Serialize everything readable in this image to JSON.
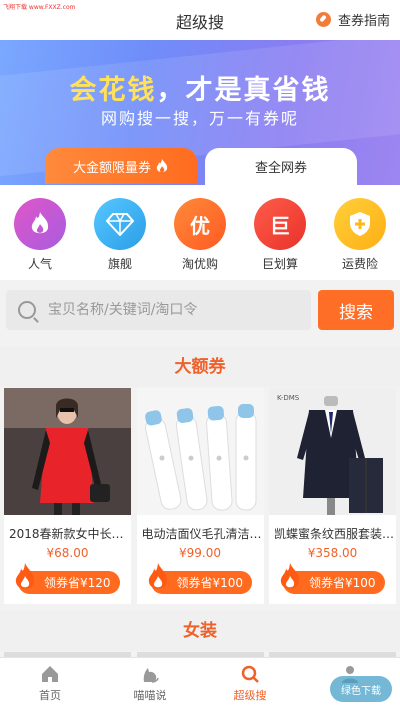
{
  "watermark": "飞翔下载 www.FXXZ.com",
  "header": {
    "title": "超级搜",
    "guide_label": "查券指南"
  },
  "banner": {
    "headline_highlight": "会花钱",
    "headline_rest": "，才是真省钱",
    "subtitle": "网购搜一搜，万一有券呢",
    "tabs": [
      {
        "label": "大金额限量券"
      },
      {
        "label": "查全网券"
      }
    ]
  },
  "categories": [
    {
      "label": "人气",
      "icon": "flame-icon",
      "color": "#c35bd6",
      "glyph": ""
    },
    {
      "label": "旗舰",
      "icon": "diamond-icon",
      "color": "#3fb4f1",
      "glyph": ""
    },
    {
      "label": "淘优购",
      "icon": "you-icon",
      "color": "#ff6b2e",
      "glyph": "优"
    },
    {
      "label": "巨划算",
      "icon": "ju-icon",
      "color": "#f4433a",
      "glyph": "巨"
    },
    {
      "label": "运费险",
      "icon": "shield-plus-icon",
      "color": "#ffbf1f",
      "glyph": ""
    }
  ],
  "search": {
    "placeholder": "宝贝名称/关键词/淘口令",
    "button": "搜索"
  },
  "sections": {
    "big_coupon": "大额券",
    "women": "女装"
  },
  "products": [
    {
      "title": "2018春新款女中长…",
      "price": "¥68.00",
      "coupon": "领券省¥120"
    },
    {
      "title": "电动洁面仪毛孔清洁…",
      "price": "¥99.00",
      "coupon": "领券省¥100"
    },
    {
      "title": "凯蝶蜜条纹西服套装…",
      "price": "¥358.00",
      "coupon": "领券省¥100"
    }
  ],
  "product_image_text": "K-DMS",
  "nav": [
    {
      "label": "首页",
      "icon": "home-icon"
    },
    {
      "label": "喵喵说",
      "icon": "cat-icon"
    },
    {
      "label": "超级搜",
      "icon": "search-icon",
      "active": true
    },
    {
      "label": "",
      "icon": "user-icon"
    }
  ],
  "dl_badge": "绿色下载"
}
